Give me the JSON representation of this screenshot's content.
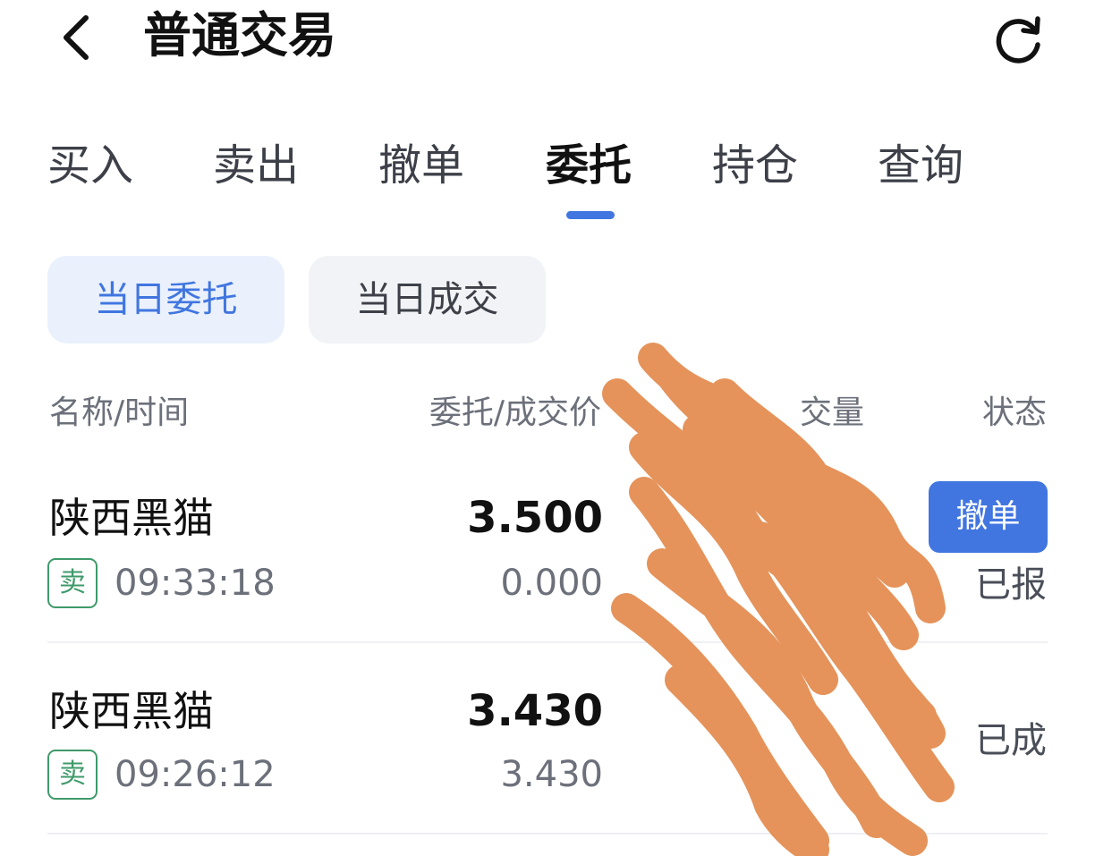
{
  "header": {
    "title": "普通交易",
    "back_icon": "chevron-left-icon",
    "refresh_icon": "refresh-icon"
  },
  "tabs": [
    {
      "label": "买入",
      "active": false
    },
    {
      "label": "卖出",
      "active": false
    },
    {
      "label": "撤单",
      "active": false
    },
    {
      "label": "委托",
      "active": true
    },
    {
      "label": "持仓",
      "active": false
    },
    {
      "label": "查询",
      "active": false
    }
  ],
  "filters": [
    {
      "label": "当日委托",
      "selected": true
    },
    {
      "label": "当日成交",
      "selected": false
    }
  ],
  "columns": {
    "name_time": "名称/时间",
    "price": "委托/成交价",
    "qty": "交量",
    "status": "状态"
  },
  "orders": [
    {
      "name": "陕西黑猫",
      "side": "卖",
      "time": "09:33:18",
      "order_price": "3.500",
      "fill_price": "0.000",
      "status": "已报",
      "action": "撤单"
    },
    {
      "name": "陕西黑猫",
      "side": "卖",
      "time": "09:26:12",
      "order_price": "3.430",
      "fill_price": "3.430",
      "status": "已成",
      "action": ""
    }
  ],
  "colors": {
    "accent": "#4176e0",
    "sell_badge": "#3f9a6a",
    "redaction": "#e5935a"
  }
}
